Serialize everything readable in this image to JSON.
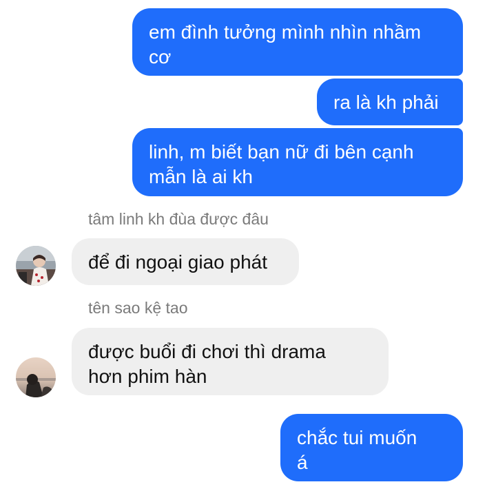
{
  "messages": [
    {
      "direction": "outgoing",
      "text": "em đình tưởng mình nhìn nhầm\ncơ"
    },
    {
      "direction": "outgoing",
      "text": "ra là kh phải"
    },
    {
      "direction": "outgoing",
      "text": "linh, m biết bạn nữ đi bên cạnh\nmẫn là ai kh"
    },
    {
      "direction": "incoming",
      "sender": "tâm linh kh đùa được đâu",
      "text": "để đi ngoại giao phát"
    },
    {
      "direction": "incoming",
      "sender": "tên sao kệ tao",
      "text": "được buổi đi chơi thì drama\nhơn phim hàn"
    },
    {
      "direction": "outgoing",
      "text": "chắc tui muốn\ná"
    }
  ],
  "colors": {
    "outgoing_bubble": "#1f6dfb",
    "incoming_bubble": "#efefef",
    "sender_name": "#7a7a7a"
  }
}
